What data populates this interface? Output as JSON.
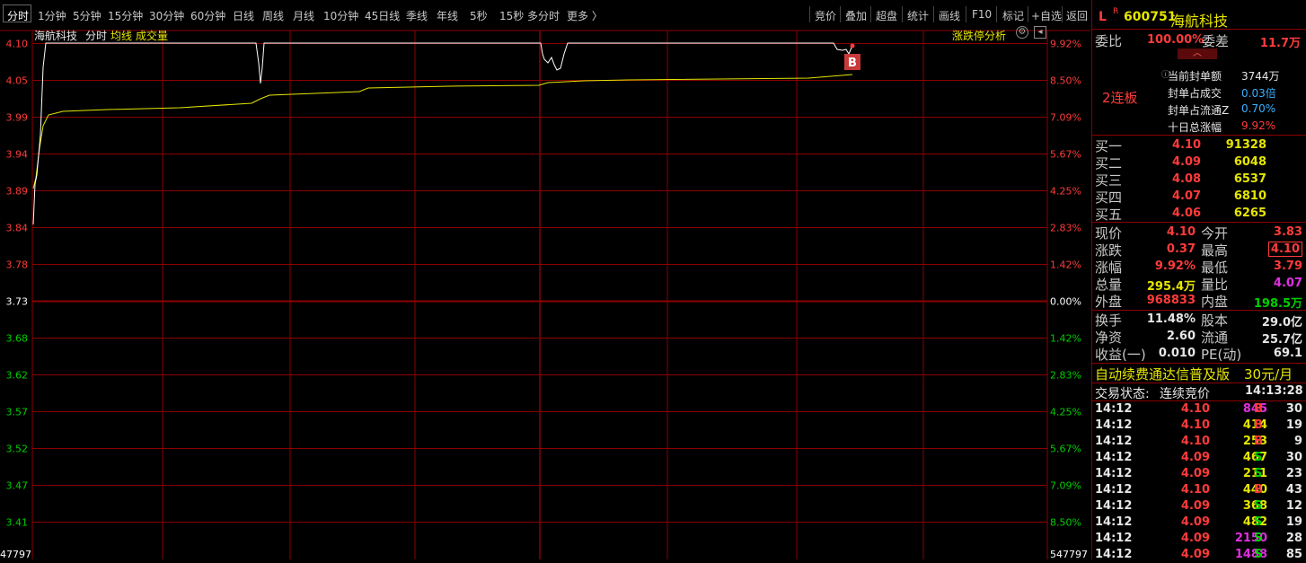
{
  "toolbar": {
    "periods": [
      "分时",
      "1分钟",
      "5分钟",
      "15分钟",
      "30分钟",
      "60分钟",
      "日线",
      "周线",
      "月线",
      "10分钟",
      "45日线",
      "季线",
      "年线",
      "5秒",
      "15秒",
      "多分时",
      "更多 〉"
    ],
    "tools": [
      "竞价",
      "叠加",
      "超盘",
      "统计",
      "画线",
      "F10",
      "标记",
      "+自选",
      "返回"
    ]
  },
  "chart_header": {
    "stock_name": "海航科技",
    "mode": "分时",
    "avg_label": "均线",
    "vol_label": "成交量",
    "analysis_btn": "涨跌停分析"
  },
  "chart": {
    "price_labels": [
      "4.10",
      "4.05",
      "3.99",
      "3.94",
      "3.89",
      "3.84",
      "3.78",
      "3.73",
      "3.68",
      "3.62",
      "3.57",
      "3.52",
      "3.47",
      "3.41"
    ],
    "pct_labels": [
      "9.92%",
      "8.50%",
      "7.09%",
      "5.67%",
      "4.25%",
      "2.83%",
      "1.42%",
      "0.00%",
      "1.42%",
      "2.83%",
      "4.25%",
      "5.67%",
      "7.09%",
      "8.50%"
    ],
    "bottom_left_label": "47797",
    "bottom_right_label": "547797",
    "b_marker": "B",
    "colors": {
      "up": "#ff3b3b",
      "down": "#00d000",
      "flat": "#ffffff",
      "grid": "#8b0000",
      "price_line": "#ffffff",
      "avg_line": "#e6e600"
    }
  },
  "panel": {
    "market_flag": "L",
    "margin_flag": "R",
    "code": "600751",
    "name": "海航科技",
    "weibi_label": "委比",
    "weibi_value": "100.00%",
    "weicha_label": "委差",
    "weicha_value": "11.7万",
    "streak": "2连板",
    "seal_stats": [
      {
        "label": "当前封单额",
        "value": "3744万"
      },
      {
        "label": "封单占成交",
        "value": "0.03倍"
      },
      {
        "label": "封单占流通Z",
        "value": "0.70%"
      },
      {
        "label": "十日总涨幅",
        "value": "9.92%"
      }
    ],
    "bids": [
      {
        "label": "买一",
        "price": "4.10",
        "vol": "91328"
      },
      {
        "label": "买二",
        "price": "4.09",
        "vol": "6048"
      },
      {
        "label": "买三",
        "price": "4.08",
        "vol": "6537"
      },
      {
        "label": "买四",
        "price": "4.07",
        "vol": "6810"
      },
      {
        "label": "买五",
        "price": "4.06",
        "vol": "6265"
      }
    ],
    "quote": [
      {
        "l1": "现价",
        "v1": "4.10",
        "c1": "red",
        "l2": "今开",
        "v2": "3.83",
        "c2": "red"
      },
      {
        "l1": "涨跌",
        "v1": "0.37",
        "c1": "red",
        "l2": "最高",
        "v2": "4.10",
        "c2": "red"
      },
      {
        "l1": "涨幅",
        "v1": "9.92%",
        "c1": "red",
        "l2": "最低",
        "v2": "3.79",
        "c2": "red"
      },
      {
        "l1": "总量",
        "v1": "295.4万",
        "c1": "yellow",
        "l2": "量比",
        "v2": "4.07",
        "c2": "magenta"
      },
      {
        "l1": "外盘",
        "v1": "968833",
        "c1": "red",
        "l2": "内盘",
        "v2": "198.5万",
        "c2": "green"
      }
    ],
    "fundamentals": [
      {
        "l1": "换手",
        "v1": "11.48%",
        "l2": "股本",
        "v2": "29.0亿"
      },
      {
        "l1": "净资",
        "v1": "2.60",
        "l2": "流通",
        "v2": "25.7亿"
      },
      {
        "l1": "收益(一)",
        "v1": "0.010",
        "l2": "PE(动)",
        "v2": "69.1"
      }
    ],
    "ad_text": "自动续费通达信普及版",
    "ad_price": "30元/月",
    "status_label": "交易状态:",
    "status_value": "连续竞价",
    "status_time": "14:13:28",
    "ticks": [
      {
        "time": "14:12",
        "price": "4.10",
        "vol": "845",
        "side": "B",
        "n": "30",
        "vc": "magenta"
      },
      {
        "time": "14:12",
        "price": "4.10",
        "vol": "414",
        "side": "B",
        "n": "19",
        "vc": "yellow"
      },
      {
        "time": "14:12",
        "price": "4.10",
        "vol": "253",
        "side": "B",
        "n": "9",
        "vc": "yellow"
      },
      {
        "time": "14:12",
        "price": "4.09",
        "vol": "467",
        "side": "S",
        "n": "30",
        "vc": "yellow"
      },
      {
        "time": "14:12",
        "price": "4.09",
        "vol": "211",
        "side": "S",
        "n": "23",
        "vc": "yellow"
      },
      {
        "time": "14:12",
        "price": "4.10",
        "vol": "440",
        "side": "B",
        "n": "43",
        "vc": "yellow"
      },
      {
        "time": "14:12",
        "price": "4.09",
        "vol": "368",
        "side": "S",
        "n": "12",
        "vc": "yellow"
      },
      {
        "time": "14:12",
        "price": "4.09",
        "vol": "482",
        "side": "S",
        "n": "19",
        "vc": "yellow"
      },
      {
        "time": "14:12",
        "price": "4.09",
        "vol": "2150",
        "side": "S",
        "n": "28",
        "vc": "magenta"
      },
      {
        "time": "14:12",
        "price": "4.09",
        "vol": "1488",
        "side": "S",
        "n": "85",
        "vc": "magenta"
      }
    ]
  }
}
